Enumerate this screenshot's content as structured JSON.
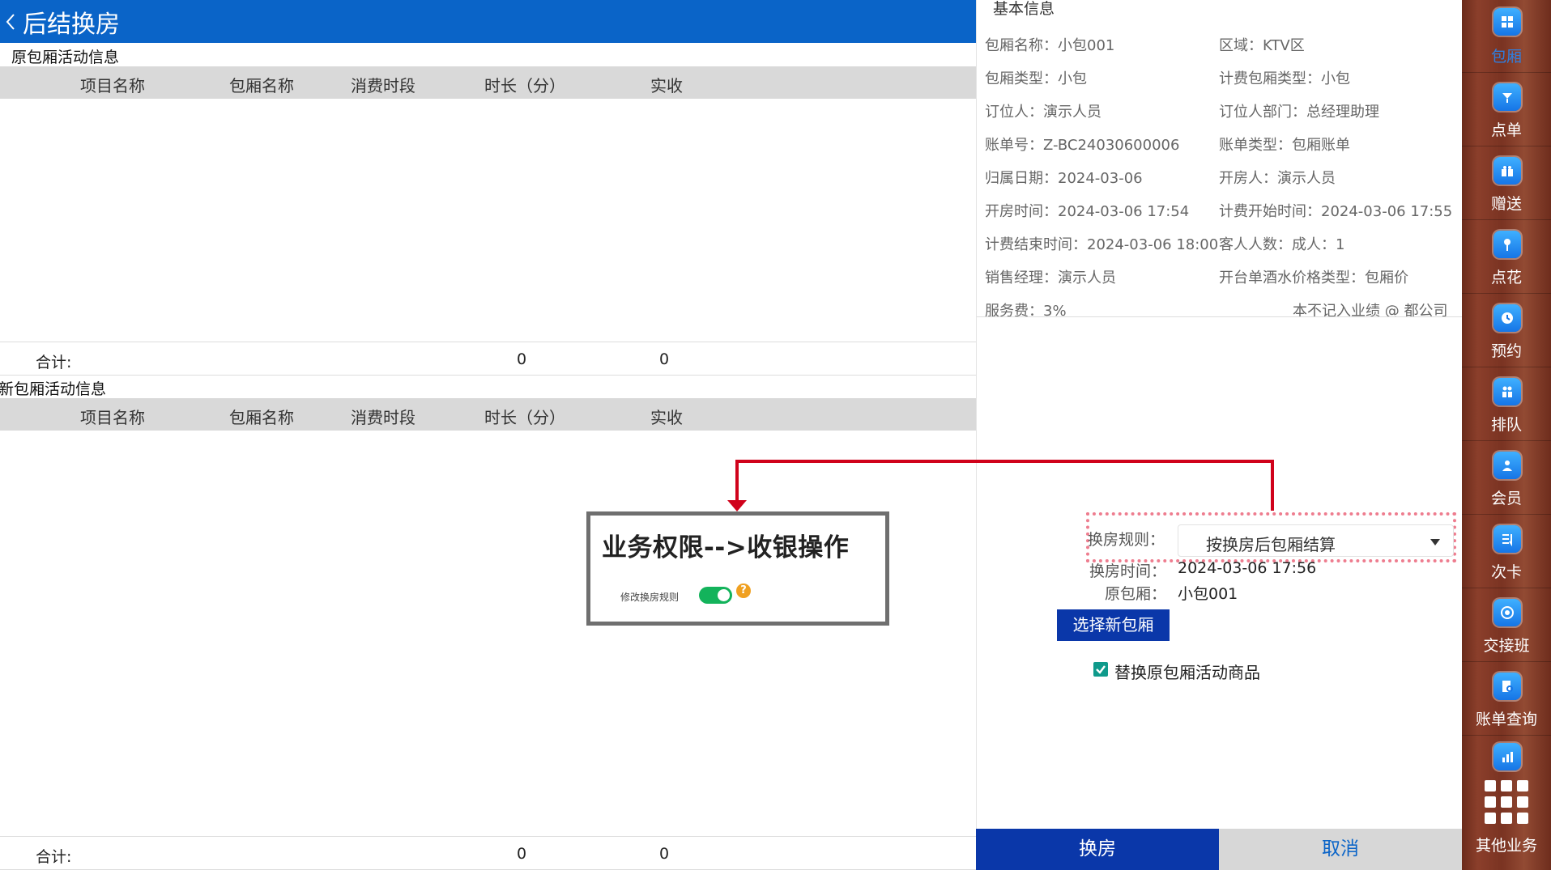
{
  "topbar": {
    "title": "后结换房"
  },
  "original": {
    "section_title": "原包厢活动信息",
    "columns": [
      "项目名称",
      "包厢名称",
      "消费时段",
      "时长（分）",
      "实收"
    ],
    "total_label": "合计:",
    "total_duration": "0",
    "total_received": "0"
  },
  "new": {
    "section_title": "新包厢活动信息",
    "columns": [
      "项目名称",
      "包厢名称",
      "消费时段",
      "时长（分）",
      "实收"
    ],
    "total_label": "合计:",
    "total_duration": "0",
    "total_received": "0"
  },
  "permission_callout": {
    "title": "业务权限-->收银操作",
    "toggle_label": "修改换房规则",
    "toggle_on": true,
    "help_glyph": "?"
  },
  "info": {
    "heading": "基本信息",
    "items": [
      "包厢名称：小包001",
      "区域：KTV区",
      "包厢类型：小包",
      "计费包厢类型：小包",
      "订位人：演示人员",
      "订位人部门：总经理助理",
      "账单号：Z-BC24030600006",
      "账单类型：包厢账单",
      "归属日期：2024-03-06",
      "开房人：演示人员",
      "开房时间：2024-03-06 17:54",
      "计费开始时间：2024-03-06 17:55",
      "计费结束时间：2024-03-06 18:00",
      "客人人数：成人：1",
      "销售经理：演示人员",
      "开台单酒水价格类型：包厢价",
      "服务费：3%",
      "本不记入业绩 @ 都公司"
    ]
  },
  "change": {
    "rule_label": "换房规则：",
    "rule_value": "按换房后包厢结算",
    "time_label": "换房时间：",
    "time_value": "2024-03-06 17:56",
    "room_label": "原包厢：",
    "room_value": "小包001",
    "select_new_room": "选择新包厢",
    "replace_checkbox_label": "替换原包厢活动商品",
    "replace_checked": true
  },
  "actions": {
    "confirm": "换房",
    "cancel": "取消"
  },
  "sidebar": {
    "items": [
      {
        "label": "包厢",
        "icon": "grid-icon",
        "active": true
      },
      {
        "label": "点单",
        "icon": "order-icon"
      },
      {
        "label": "赠送",
        "icon": "gift-icon"
      },
      {
        "label": "点花",
        "icon": "flower-icon"
      },
      {
        "label": "预约",
        "icon": "reservation-icon"
      },
      {
        "label": "排队",
        "icon": "queue-icon"
      },
      {
        "label": "会员",
        "icon": "member-icon"
      },
      {
        "label": "次卡",
        "icon": "card-icon"
      },
      {
        "label": "交接班",
        "icon": "handover-icon"
      },
      {
        "label": "账单查询",
        "icon": "bill-search-icon"
      },
      {
        "label": "",
        "icon": "report-icon"
      }
    ],
    "more_label": "其他业务"
  },
  "colors": {
    "primary": "#0a64c8",
    "button": "#0a37a9",
    "toggle": "#13b35b",
    "annotation": "#d0021b"
  }
}
